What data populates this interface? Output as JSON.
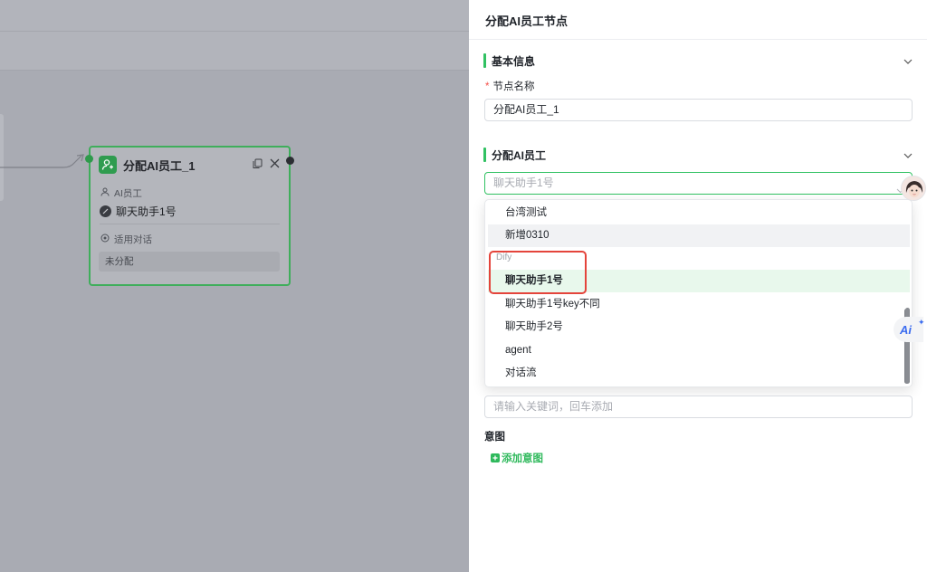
{
  "canvas": {
    "node": {
      "title": "分配AI员工_1",
      "ai_employee_label": "AI员工",
      "assistant_name": "聊天助手1号",
      "scope_label": "适用对话",
      "status": "未分配"
    }
  },
  "panel": {
    "title": "分配AI员工节点",
    "basic_section": {
      "title": "基本信息",
      "node_name_label": "节点名称",
      "required_mark": "*",
      "node_name_value": "分配AI员工_1"
    },
    "assign_section": {
      "title": "分配AI员工",
      "select_value": "聊天助手1号",
      "dropdown": {
        "items_before": [
          "台湾测试",
          "新增0310"
        ],
        "group_label": "Dify",
        "selected": "聊天助手1号",
        "items_after": [
          "聊天助手1号key不同",
          "聊天助手2号",
          "agent",
          "对话流"
        ]
      }
    },
    "keyword_placeholder": "请输入关键词，回车添加",
    "intent_label": "意图",
    "add_intent_label": "添加意图",
    "ai_fab_label": "Ai"
  },
  "colors": {
    "accent": "#31c162",
    "selected_bg": "#e8f8ec",
    "highlight_red": "#e4443b",
    "overlay": "#a9abb3"
  },
  "icons": [
    "copy-icon",
    "close-icon",
    "chevron-down-icon",
    "user-icon",
    "ai-employee-icon",
    "add-icon"
  ]
}
